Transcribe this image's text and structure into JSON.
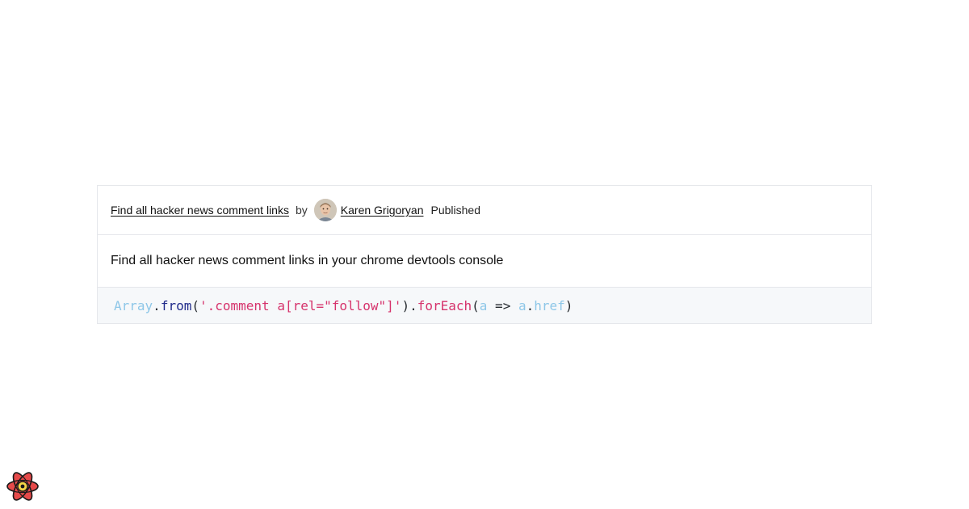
{
  "header": {
    "title_link": "Find all hacker news comment links",
    "by_label": "by",
    "author_name": "Karen Grigoryan",
    "status": "Published"
  },
  "description": "Find all hacker news comment links in your chrome devtools console",
  "code": {
    "tokens": [
      {
        "text": "Array",
        "kind": "ident"
      },
      {
        "text": ".",
        "kind": "punc"
      },
      {
        "text": "from",
        "kind": "method"
      },
      {
        "text": "(",
        "kind": "punc"
      },
      {
        "text": "'.comment a[rel=\"follow\"]'",
        "kind": "string"
      },
      {
        "text": ").",
        "kind": "punc"
      },
      {
        "text": "forEach",
        "kind": "call"
      },
      {
        "text": "(",
        "kind": "punc"
      },
      {
        "text": "a",
        "kind": "ident"
      },
      {
        "text": " => ",
        "kind": "op"
      },
      {
        "text": "a",
        "kind": "ident"
      },
      {
        "text": ".",
        "kind": "punc"
      },
      {
        "text": "href",
        "kind": "ident"
      },
      {
        "text": ")",
        "kind": "punc"
      }
    ]
  },
  "icons": {
    "avatar": "author-avatar",
    "logo": "react-logo-icon"
  },
  "colors": {
    "border": "#e5e7eb",
    "code_background": "#f6f8fa",
    "string": "#d6336c",
    "identifier": "#8ec7e8",
    "method": "#1f2a8a"
  }
}
